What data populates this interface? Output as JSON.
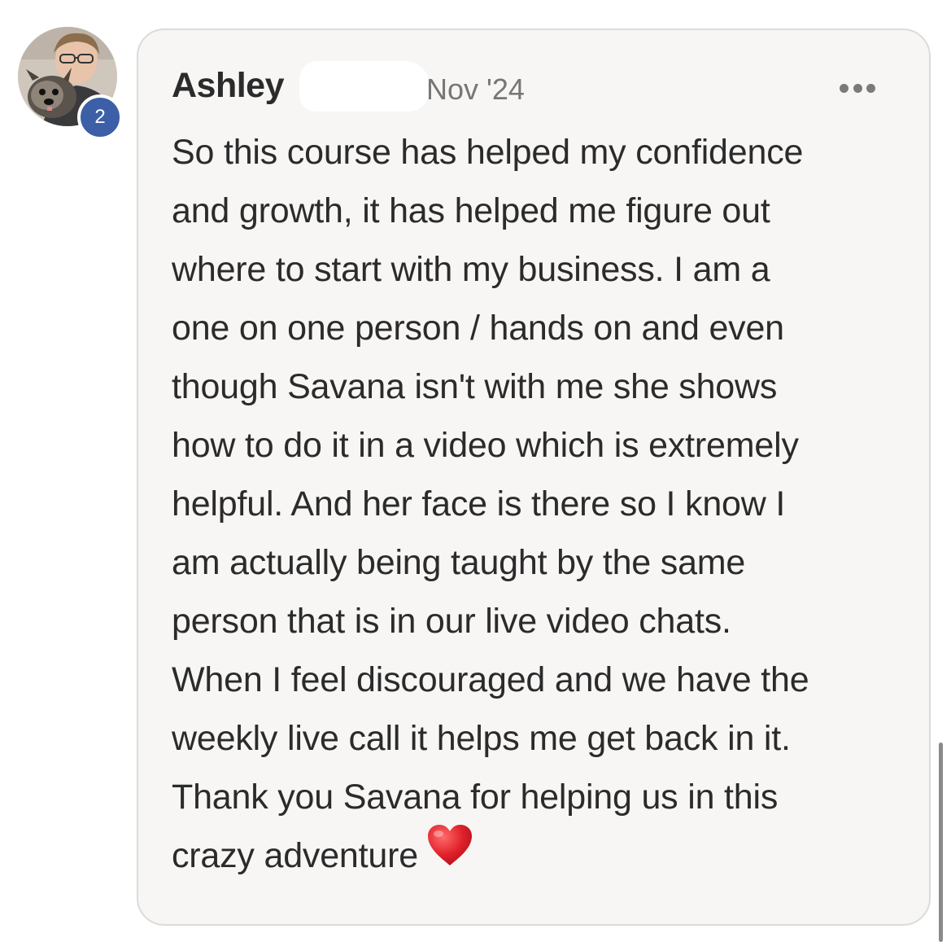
{
  "post": {
    "author": "Ashley",
    "author_initial_fragment": "",
    "timestamp": "Nov '24",
    "level_badge": "2",
    "body_lines": [
      "So this course has helped my confidence",
      "and growth, it has helped me figure out",
      "where to start with my business. I am a",
      "one on one person / hands on and even",
      "though Savana isn't with me she shows",
      "how to do it in a video which is extremely",
      "helpful. And her face is there so I know I",
      "am actually being taught by the same",
      "person that is in our live video chats.",
      "When I feel discouraged and we have the",
      "weekly live call it helps me get back in it.",
      "Thank you Savana for helping us in this",
      "crazy adventure"
    ],
    "emoji": "heart-emoji"
  },
  "colors": {
    "card_background": "#f7f6f5",
    "card_border": "#dcdbd9",
    "badge": "#3c5fa8",
    "text": "#2b2b2b",
    "muted": "#767676",
    "heart": "#e0202a"
  },
  "icons": {
    "more": "more-options-icon",
    "avatar": "user-avatar"
  }
}
